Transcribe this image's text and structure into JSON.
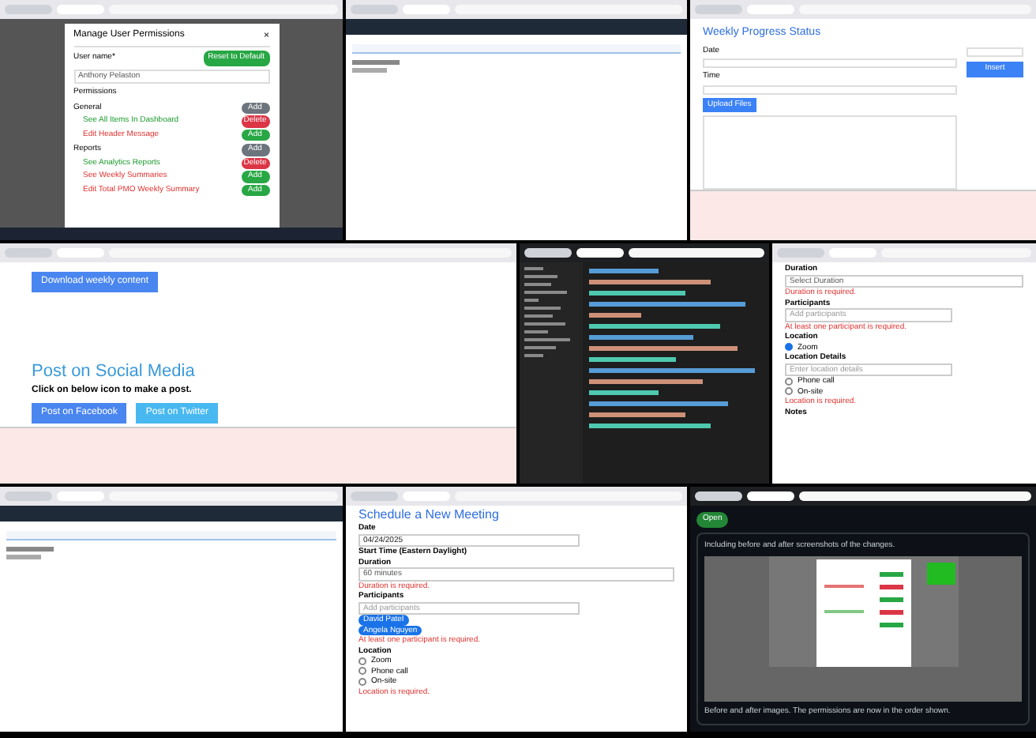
{
  "tiles": [
    {
      "kind": "permissions",
      "title": "Manage User Permissions",
      "close": "×",
      "user_label": "User name*",
      "user_value": "Anthony Pelaston",
      "reset": "Reset to Default",
      "permissions_label": "Permissions",
      "groups": [
        {
          "name": "General",
          "action": "Add",
          "items": [
            {
              "label": "See All Items In Dashboard",
              "granted": true,
              "action": "Delete"
            },
            {
              "label": "Edit Header Message",
              "granted": false,
              "action": "Add"
            }
          ]
        },
        {
          "name": "Reports",
          "action": "Add",
          "items": [
            {
              "label": "See Analytics Reports",
              "granted": true,
              "action": "Delete"
            },
            {
              "label": "See Weekly Summaries",
              "granted": false,
              "action": "Add"
            },
            {
              "label": "Edit Total PMO Weekly Summary",
              "granted": false,
              "action": "Add"
            }
          ]
        }
      ]
    },
    {
      "kind": "app_page"
    },
    {
      "kind": "editor_form",
      "title": "Weekly Progress Status",
      "fields": [
        "Date",
        "Time"
      ],
      "upload": "Upload Files",
      "submit": "Insert"
    },
    {
      "kind": "social",
      "top_button": "Download weekly content",
      "title": "Post on Social Media",
      "subtitle": "Click on below icon to make a post.",
      "buttons": [
        "Post on Facebook",
        "Post on Twitter"
      ]
    },
    {
      "kind": "code_editor"
    },
    {
      "kind": "form",
      "items": [
        {
          "kind": "label",
          "text": "Duration"
        },
        {
          "kind": "select",
          "text": "Select Duration"
        },
        {
          "kind": "error",
          "text": "Duration is required."
        },
        {
          "kind": "label",
          "text": "Participants"
        },
        {
          "kind": "input",
          "placeholder": "Add participants"
        },
        {
          "kind": "error",
          "text": "At least one participant is required."
        },
        {
          "kind": "label",
          "text": "Location"
        },
        {
          "kind": "radio",
          "text": "Zoom",
          "selected": true
        },
        {
          "kind": "label",
          "text": "Location Details"
        },
        {
          "kind": "input",
          "placeholder": "Enter location details"
        },
        {
          "kind": "radio",
          "text": "Phone call",
          "selected": false
        },
        {
          "kind": "radio",
          "text": "On-site",
          "selected": false
        },
        {
          "kind": "error",
          "text": "Location is required."
        },
        {
          "kind": "label",
          "text": "Notes"
        }
      ]
    },
    {
      "kind": "app_page"
    },
    {
      "kind": "form",
      "items": [
        {
          "kind": "heading",
          "text": "Schedule a New Meeting"
        },
        {
          "kind": "label",
          "text": "Date"
        },
        {
          "kind": "input",
          "value": "04/24/2025"
        },
        {
          "kind": "label",
          "text": "Start Time (Eastern Daylight)"
        },
        {
          "kind": "label",
          "text": "Duration"
        },
        {
          "kind": "select",
          "text": "60 minutes"
        },
        {
          "kind": "error",
          "text": "Duration is required."
        },
        {
          "kind": "label",
          "text": "Participants"
        },
        {
          "kind": "input",
          "placeholder": "Add participants"
        },
        {
          "kind": "chip",
          "text": "David Patel"
        },
        {
          "kind": "chip",
          "text": "Angela Nguyen"
        },
        {
          "kind": "error",
          "text": "At least one participant is required."
        },
        {
          "kind": "label",
          "text": "Location"
        },
        {
          "kind": "radio",
          "text": "Zoom",
          "selected": false
        },
        {
          "kind": "radio",
          "text": "Phone call",
          "selected": false
        },
        {
          "kind": "radio",
          "text": "On-site",
          "selected": false
        },
        {
          "kind": "error",
          "text": "Location is required."
        }
      ]
    },
    {
      "kind": "github",
      "badge": "Open",
      "comment": "Including before and after screenshots of the changes.",
      "footer": "Before and after images. The permissions are now in the order shown."
    }
  ]
}
